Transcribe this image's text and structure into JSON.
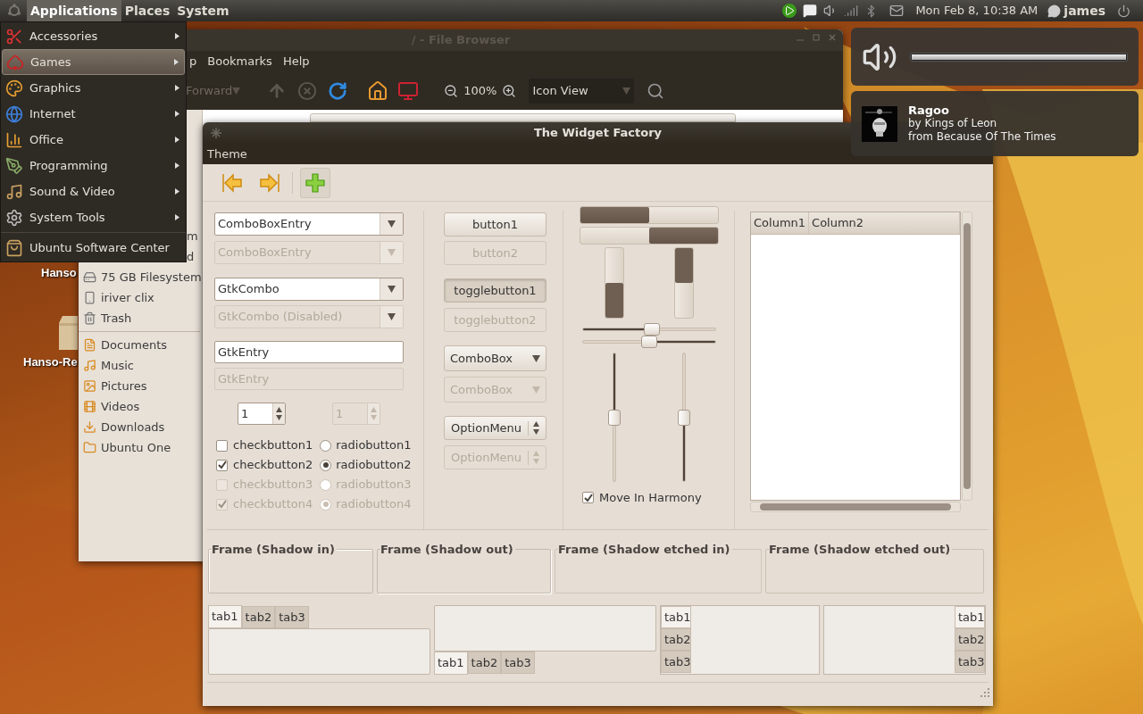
{
  "panel": {
    "menus": [
      {
        "label": "Applications",
        "selected": true
      },
      {
        "label": "Places",
        "selected": false
      },
      {
        "label": "System",
        "selected": false
      }
    ],
    "clock": "Mon Feb 8, 10:38 AM",
    "user": "james"
  },
  "desktop_icons": [
    {
      "label": "Hanso"
    },
    {
      "label": "Hanso-Re"
    }
  ],
  "file_browser": {
    "title": "/ - File Browser",
    "menus": [
      "p",
      "Bookmarks",
      "Help"
    ],
    "toolbar": {
      "forward": "Forward",
      "zoom": "100%",
      "view": "Icon View"
    },
    "sidebar": [
      {
        "label": "m",
        "kind": "partial"
      },
      {
        "label": "d",
        "kind": "partial"
      },
      {
        "label": "75 GB Filesystem",
        "kind": "item"
      },
      {
        "label": "iriver clix",
        "kind": "item"
      },
      {
        "label": "Trash",
        "kind": "item"
      },
      {
        "kind": "separator"
      },
      {
        "label": "Documents",
        "kind": "item"
      },
      {
        "label": "Music",
        "kind": "item"
      },
      {
        "label": "Pictures",
        "kind": "item"
      },
      {
        "label": "Videos",
        "kind": "item"
      },
      {
        "label": "Downloads",
        "kind": "item"
      },
      {
        "label": "Ubuntu One",
        "kind": "item"
      }
    ]
  },
  "app_menu": {
    "items": [
      {
        "label": "Accessories",
        "selected": false
      },
      {
        "label": "Games",
        "selected": true
      },
      {
        "label": "Graphics",
        "selected": false
      },
      {
        "label": "Internet",
        "selected": false
      },
      {
        "label": "Office",
        "selected": false
      },
      {
        "label": "Programming",
        "selected": false
      },
      {
        "label": "Sound & Video",
        "selected": false
      },
      {
        "label": "System Tools",
        "selected": false
      }
    ],
    "footer_items": [
      {
        "label": "Ubuntu Software Center",
        "selected": false
      }
    ]
  },
  "volume": {
    "level": 1
  },
  "now_playing": {
    "title": "Ragoo",
    "artist": "by Kings of Leon",
    "album": "from Because Of The Times"
  },
  "widget_factory": {
    "title": "The Widget Factory",
    "menus": [
      "Theme"
    ],
    "toolbar": [
      {
        "kind": "back",
        "active": false
      },
      {
        "kind": "forward",
        "active": false
      },
      {
        "kind": "add",
        "active": true
      }
    ],
    "column_1": [
      {
        "kind": "combo_entry",
        "value": "ComboBoxEntry",
        "disabled": false
      },
      {
        "kind": "combo_entry",
        "value": "ComboBoxEntry",
        "disabled": true
      },
      {
        "kind": "combo",
        "value": "GtkCombo",
        "disabled": false
      },
      {
        "kind": "combo",
        "value": "GtkCombo (Disabled)",
        "disabled": true
      },
      {
        "kind": "entry",
        "value": "GtkEntry",
        "disabled": false
      },
      {
        "kind": "entry",
        "value": "GtkEntry",
        "disabled": true
      }
    ],
    "spins": [
      {
        "value": "1",
        "disabled": false
      },
      {
        "value": "1",
        "disabled": true
      }
    ],
    "checks": [
      {
        "label": "checkbutton1",
        "checked": false,
        "disabled": false
      },
      {
        "label": "checkbutton2",
        "checked": true,
        "disabled": false
      },
      {
        "label": "checkbutton3",
        "checked": false,
        "disabled": true
      },
      {
        "label": "checkbutton4",
        "checked": true,
        "disabled": true
      }
    ],
    "radios": [
      {
        "label": "radiobutton1",
        "selected": false,
        "disabled": false
      },
      {
        "label": "radiobutton2",
        "selected": true,
        "disabled": false
      },
      {
        "label": "radiobutton3",
        "selected": false,
        "disabled": true
      },
      {
        "label": "radiobutton4",
        "selected": true,
        "disabled": true
      }
    ],
    "column_2": [
      {
        "kind": "button",
        "label": "button1",
        "disabled": false
      },
      {
        "kind": "button",
        "label": "button2",
        "disabled": true
      },
      {
        "kind": "toggle",
        "label": "togglebutton1",
        "disabled": false,
        "active": true
      },
      {
        "kind": "toggle",
        "label": "togglebutton2",
        "disabled": true,
        "active": false
      },
      {
        "kind": "combobox",
        "label": "ComboBox",
        "disabled": false
      },
      {
        "kind": "combobox",
        "label": "ComboBox",
        "disabled": true
      },
      {
        "kind": "optionmenu",
        "label": "OptionMenu",
        "disabled": false
      },
      {
        "kind": "optionmenu",
        "label": "OptionMenu",
        "disabled": true
      }
    ],
    "hbars": [
      {
        "level": 0.5,
        "inverted": false
      },
      {
        "level": 0.5,
        "inverted": true
      }
    ],
    "vbars": [
      {
        "level": 0.5,
        "inverted": false
      },
      {
        "level": 0.5,
        "inverted": true
      }
    ],
    "hscales": [
      {
        "level": 0.52,
        "inverted": false
      },
      {
        "level": 0.5,
        "inverted": true
      }
    ],
    "vscales": [
      {
        "level": 0.5,
        "inverted": true
      },
      {
        "level": 0.5,
        "inverted": false
      }
    ],
    "harmony": {
      "label": "Move In Harmony",
      "checked": true
    },
    "tree": {
      "columns": [
        "Column1",
        "Column2"
      ]
    },
    "frames": [
      {
        "label": "Frame (Shadow in)",
        "kind": "in"
      },
      {
        "label": "Frame (Shadow out)",
        "kind": "out"
      },
      {
        "label": "Frame (Shadow etched in)",
        "kind": "etched_in"
      },
      {
        "label": "Frame (Shadow etched out)",
        "kind": "etched_out"
      }
    ],
    "notebooks": [
      {
        "kind": "top",
        "tabs": [
          {
            "label": "tab1",
            "selected": true
          },
          {
            "label": "tab2",
            "selected": false
          },
          {
            "label": "tab3",
            "selected": false
          }
        ]
      },
      {
        "kind": "bottom",
        "tabs": [
          {
            "label": "tab1",
            "selected": true
          },
          {
            "label": "tab2",
            "selected": false
          },
          {
            "label": "tab3",
            "selected": false
          }
        ]
      },
      {
        "kind": "left",
        "tabs": [
          {
            "label": "tab1",
            "selected": true
          },
          {
            "label": "tab2",
            "selected": false
          },
          {
            "label": "tab3",
            "selected": false
          }
        ]
      },
      {
        "kind": "right",
        "tabs": [
          {
            "label": "tab1",
            "selected": true
          },
          {
            "label": "tab2",
            "selected": false
          },
          {
            "label": "tab3",
            "selected": false
          }
        ]
      }
    ]
  }
}
